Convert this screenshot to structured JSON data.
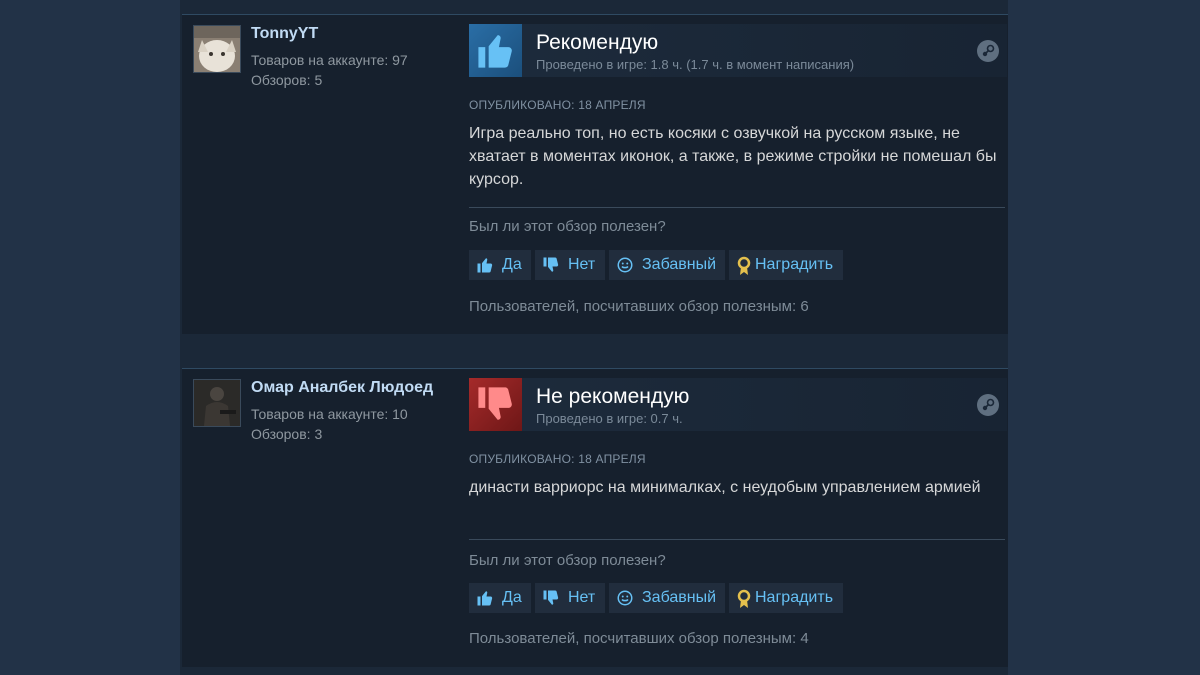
{
  "reviews": [
    {
      "username": "TonnyYT",
      "products": "Товаров на аккаунте: 97",
      "reviews_count": "Обзоров: 5",
      "verdict": "Рекомендую",
      "recommended": true,
      "hours": "Проведено в игре: 1.8 ч. (1.7 ч. в момент написания)",
      "posted": "ОПУБЛИКОВАНО: 18 АПРЕЛЯ",
      "text": "Игра реально топ, но есть косяки с озвучкой на русском языке, не хватает в моментах иконок, а также, в режиме стройки не помешал бы курсор.",
      "helpful_question": "Был ли этот обзор полезен?",
      "buttons": {
        "yes": "Да",
        "no": "Нет",
        "funny": "Забавный",
        "award": "Наградить"
      },
      "found_helpful": "Пользователей, посчитавших обзор полезным: 6"
    },
    {
      "username": "Омар Аналбек Людоед",
      "products": "Товаров на аккаунте: 10",
      "reviews_count": "Обзоров: 3",
      "verdict": "Не рекомендую",
      "recommended": false,
      "hours": "Проведено в игре: 0.7 ч.",
      "posted": "ОПУБЛИКОВАНО: 18 АПРЕЛЯ",
      "text": "династи варриорс на минималках, с неудобым управлением армией",
      "helpful_question": "Был ли этот обзор полезен?",
      "buttons": {
        "yes": "Да",
        "no": "Нет",
        "funny": "Забавный",
        "award": "Наградить"
      },
      "found_helpful": "Пользователей, посчитавших обзор полезным: 4"
    }
  ],
  "icons": {
    "thumbs_up": "thumbs-up-icon",
    "thumbs_down": "thumbs-down-icon",
    "smiley": "smiley-icon",
    "award": "award-icon",
    "steam": "steam-icon"
  },
  "colors": {
    "recommend": "#2a6ea6",
    "not_recommend": "#a52a2a",
    "link": "#66c0f4"
  }
}
